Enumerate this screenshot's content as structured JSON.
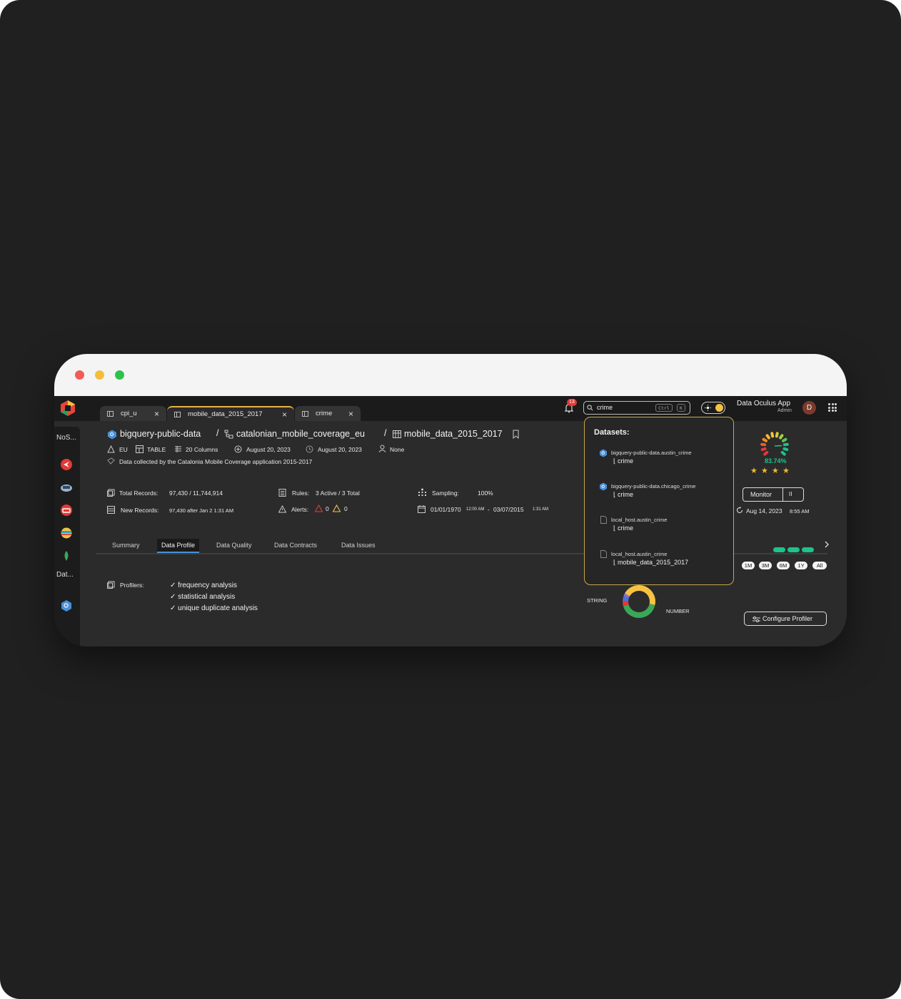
{
  "colors": {
    "accent": "#4a90d9",
    "highlight": "#e8b34a",
    "score": "#1ec28b",
    "star": "#f5b82e",
    "danger": "#e53935",
    "warning": "#f5c242"
  },
  "tabs": [
    {
      "label": "cpi_u"
    },
    {
      "label": "mobile_data_2015_2017"
    },
    {
      "label": "crime"
    }
  ],
  "header": {
    "notification_count": "13",
    "search_value": "crime",
    "search_shortcut": [
      "Ctrl",
      "K"
    ],
    "app_name": "Data Oculus App",
    "role": "Admin",
    "avatar_letter": "D"
  },
  "sidebar": {
    "labels": [
      "NoS...",
      "Dat..."
    ]
  },
  "breadcrumb": {
    "project": "bigquery-public-data",
    "separator": "/",
    "dataset": "catalonian_mobile_coverage_eu",
    "table": "mobile_data_2015_2017"
  },
  "meta": {
    "region": "EU",
    "type": "TABLE",
    "columns": "20 Columns",
    "created": "August 20, 2023",
    "updated": "August 20, 2023",
    "owner": "None",
    "description": "Data collected by the Catalonia Mobile Coverage application 2015-2017"
  },
  "stats": {
    "total_records_label": "Total Records:",
    "total_records_value": "97,430 / 11,744,914",
    "new_records_label": "New Records:",
    "new_records_value": "97,430 after Jan 2 1:31 AM",
    "rules_label": "Rules:",
    "rules_value": "3 Active / 3 Total",
    "alerts_label": "Alerts:",
    "alerts_error": "0",
    "alerts_warning": "0",
    "sampling_label": "Sampling:",
    "sampling_value": "100%",
    "range_start": "01/01/1970",
    "range_start_time": "12:00 AM",
    "range_dash": "-",
    "range_end": "03/07/2015",
    "range_end_time": "1:31 AM"
  },
  "profile_tabs": [
    "Summary",
    "Data Profile",
    "Data Quality",
    "Data Contracts",
    "Data Issues"
  ],
  "profilers": {
    "label": "Profilers:",
    "items": [
      "frequency analysis",
      "statistical analysis",
      "unique duplicate analysis"
    ]
  },
  "dropdown": {
    "title": "Datasets:",
    "items": [
      {
        "path": "bigquery-public-data.austin_crime",
        "name": "crime",
        "source": "bigquery"
      },
      {
        "path": "bigquery-public-data.chicago_crime",
        "name": "crime",
        "source": "bigquery"
      },
      {
        "path": "local_host.austin_crime",
        "name": "crime",
        "source": "file"
      },
      {
        "path": "local_host.austin_crime",
        "name": "mobile_data_2015_2017",
        "source": "file"
      }
    ]
  },
  "score": {
    "value": "83.74%",
    "stars": 4
  },
  "monitor": {
    "label": "Monitor",
    "pause": "II",
    "last_run": "Aug 14, 2023",
    "last_run_time": "8:55 AM"
  },
  "ranges": [
    "1M",
    "3M",
    "6M",
    "1Y",
    "All"
  ],
  "donut": {
    "labels": [
      "STRING",
      "NUMBER"
    ],
    "segments": [
      {
        "name": "STRING",
        "share": 0.45,
        "color": "#f5c242"
      },
      {
        "name": "NUMBER",
        "share": 0.42,
        "color": "#3aa757"
      },
      {
        "share": 0.05,
        "color": "#e53935"
      },
      {
        "share": 0.05,
        "color": "#4a72d9"
      },
      {
        "share": 0.03,
        "color": "#8f6fd0"
      }
    ]
  },
  "configure_label": "Configure Profiler"
}
